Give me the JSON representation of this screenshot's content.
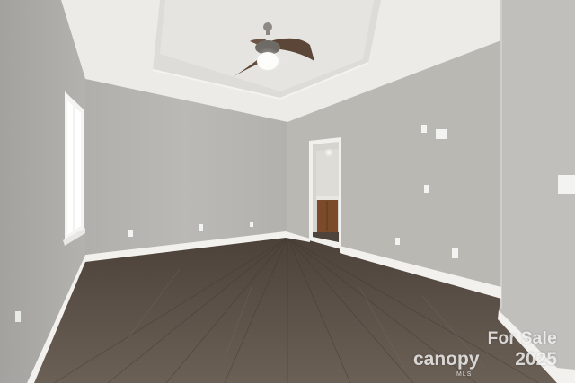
{
  "photo": {
    "subject": "empty room",
    "colors": {
      "ceiling": "#ecebe8",
      "tray_ceiling": "#e3e2de",
      "back_wall": "#b4b3af",
      "right_wall": "#b8b7b2",
      "left_wall": "#a9a8a4",
      "near_right_wall": "#c1c0bc",
      "floor": "#5a5046",
      "baseboard": "#f2f1ee",
      "fan_blade": "#5b4638"
    }
  },
  "watermark": {
    "for_sale": "For Sale",
    "brand": "canopy",
    "mls": "MLS",
    "year": "2025"
  }
}
